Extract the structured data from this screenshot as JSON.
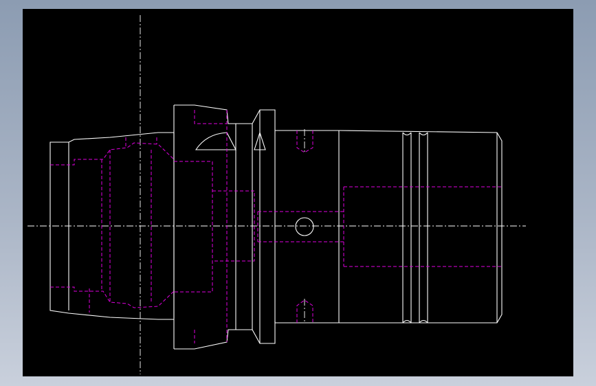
{
  "canvas": {
    "background": "#000000",
    "frame_gradient_top": "#8c9cb2",
    "frame_gradient_bottom": "#c9d0dc"
  },
  "drawing": {
    "visible_line_color": "#ffffff",
    "hidden_line_color": "#e000e0",
    "center_line_color": "#ffffff",
    "view": "side-elevation"
  }
}
